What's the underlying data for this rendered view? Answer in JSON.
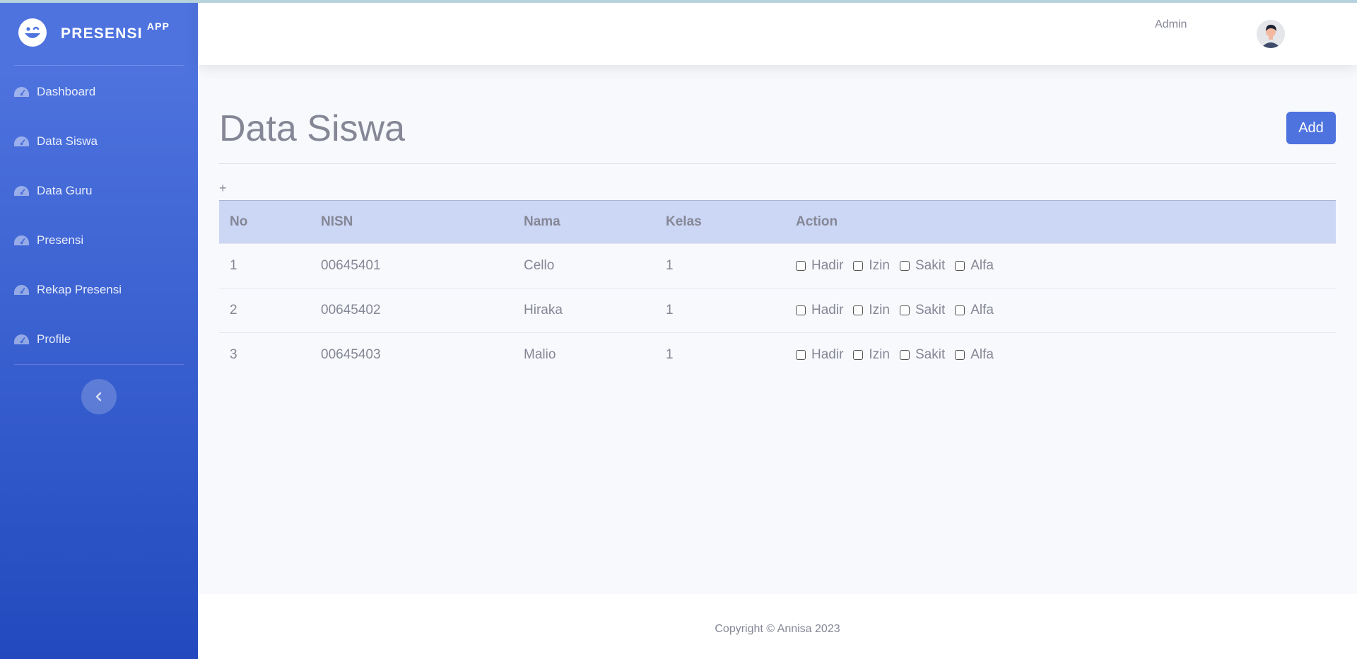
{
  "app": {
    "brand": "PRESENSI",
    "brand_sup": "APP"
  },
  "colors": {
    "primary": "#4e73df",
    "sidebar_gradient_start": "#4e73df",
    "sidebar_gradient_end": "#224abe",
    "table_header_bg": "#ccd7f5",
    "text_muted": "#858796"
  },
  "sidebar": {
    "items": [
      {
        "label": "Dashboard",
        "icon": "tachometer-icon"
      },
      {
        "label": "Data Siswa",
        "icon": "tachometer-icon"
      },
      {
        "label": "Data Guru",
        "icon": "tachometer-icon"
      },
      {
        "label": "Presensi",
        "icon": "tachometer-icon"
      },
      {
        "label": "Rekap Presensi",
        "icon": "tachometer-icon"
      },
      {
        "label": "Profile",
        "icon": "tachometer-icon"
      }
    ],
    "toggle_icon": "chevron-left-icon"
  },
  "topbar": {
    "user_name": "Admin",
    "avatar_icon": "user-avatar-icon"
  },
  "page": {
    "title": "Data Siswa",
    "add_label": "Add",
    "expand_label": "+"
  },
  "table": {
    "headers": [
      "No",
      "NISN",
      "Nama",
      "Kelas",
      "Action"
    ],
    "attendance_options": [
      "Hadir",
      "Izin",
      "Sakit",
      "Alfa"
    ],
    "rows": [
      {
        "no": "1",
        "nisn": "00645401",
        "nama": "Cello",
        "kelas": "1"
      },
      {
        "no": "2",
        "nisn": "00645402",
        "nama": "Hiraka",
        "kelas": "1"
      },
      {
        "no": "3",
        "nisn": "00645403",
        "nama": "Malio",
        "kelas": "1"
      }
    ]
  },
  "footer": {
    "copyright": "Copyright © Annisa 2023"
  }
}
